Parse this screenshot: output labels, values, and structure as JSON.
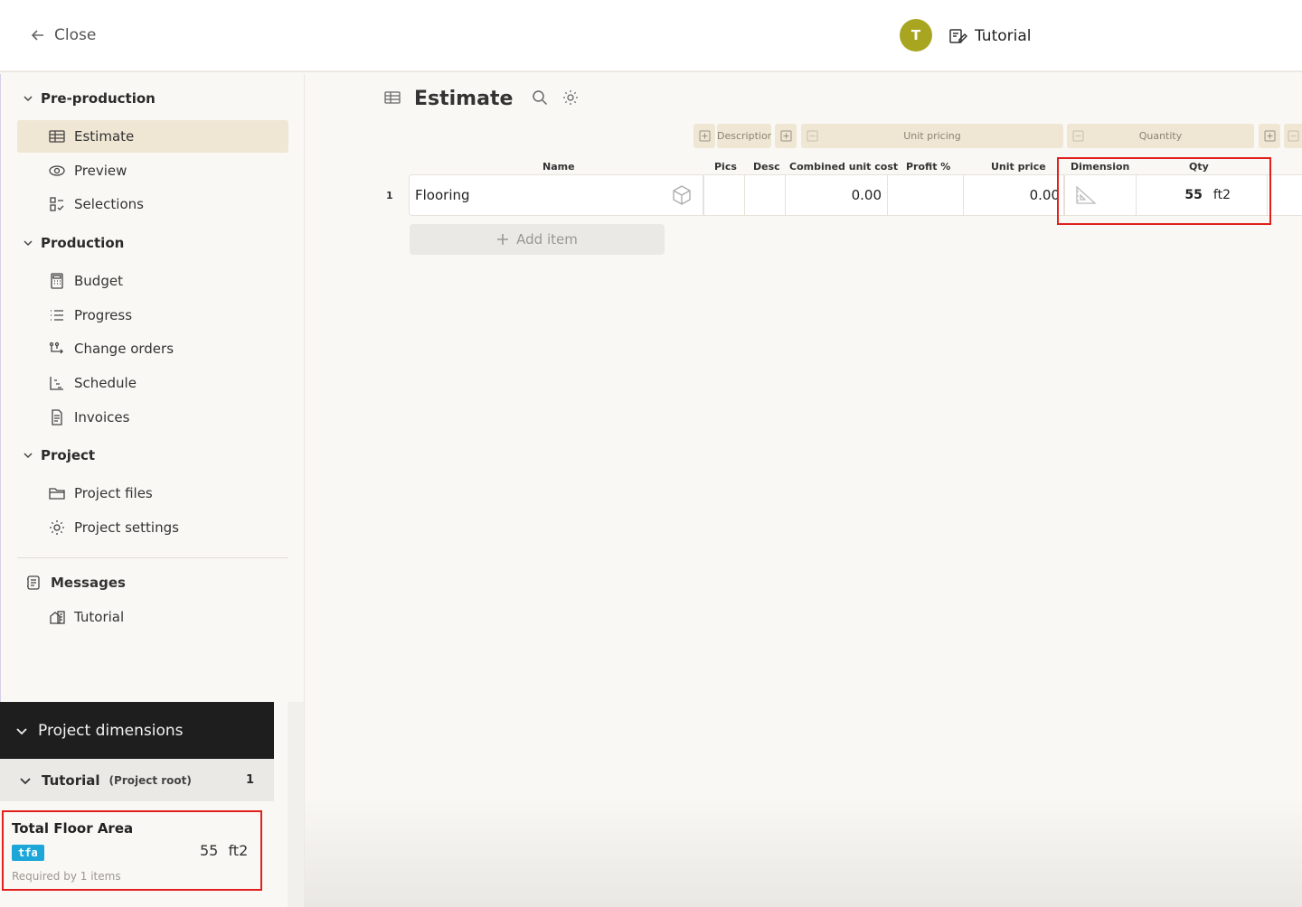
{
  "topbar": {
    "close_label": "Close",
    "avatar_initial": "T",
    "project_name": "Tutorial"
  },
  "sidebar": {
    "sections": [
      {
        "label": "Pre-production"
      },
      {
        "label": "Production"
      },
      {
        "label": "Project"
      }
    ],
    "items": [
      {
        "label": "Estimate",
        "icon": "table-icon",
        "active": true
      },
      {
        "label": "Preview",
        "icon": "eye-icon"
      },
      {
        "label": "Selections",
        "icon": "selections-icon"
      },
      {
        "label": "Budget",
        "icon": "calculator-icon"
      },
      {
        "label": "Progress",
        "icon": "list-icon"
      },
      {
        "label": "Change orders",
        "icon": "change-orders-icon"
      },
      {
        "label": "Schedule",
        "icon": "schedule-icon"
      },
      {
        "label": "Invoices",
        "icon": "invoice-icon"
      },
      {
        "label": "Project files",
        "icon": "folder-icon"
      },
      {
        "label": "Project settings",
        "icon": "gear-icon"
      },
      {
        "label": "Messages",
        "icon": "messages-icon"
      },
      {
        "label": "Tutorial",
        "icon": "house-icon"
      }
    ]
  },
  "main": {
    "title": "Estimate",
    "groups": {
      "description": "Description",
      "unit_pricing": "Unit pricing",
      "quantity": "Quantity"
    },
    "columns": {
      "name": "Name",
      "pics": "Pics",
      "desc": "Desc",
      "combined_unit_cost": "Combined unit cost",
      "profit": "Profit %",
      "unit_price": "Unit price",
      "dimension": "Dimension",
      "qty": "Qty"
    },
    "rows": [
      {
        "number": "1",
        "name": "Flooring",
        "combined_unit_cost": "0.00",
        "unit_price": "0.00",
        "qty": "55",
        "unit": "ft2"
      }
    ],
    "add_item_label": "Add item"
  },
  "dimensions_panel": {
    "title": "Project dimensions",
    "group_name": "Tutorial",
    "group_sub": "(Project root)",
    "group_count": "1",
    "dimension": {
      "name": "Total Floor Area",
      "tag": "tfa",
      "value": "55",
      "unit": "ft2",
      "required_by": "Required by 1 items"
    }
  },
  "colors": {
    "accent_beige": "#efe6d4",
    "avatar": "#a8a620",
    "tag_blue": "#1da7d8",
    "highlight_red": "#e0201d",
    "dark_header": "#1e1e1e"
  }
}
